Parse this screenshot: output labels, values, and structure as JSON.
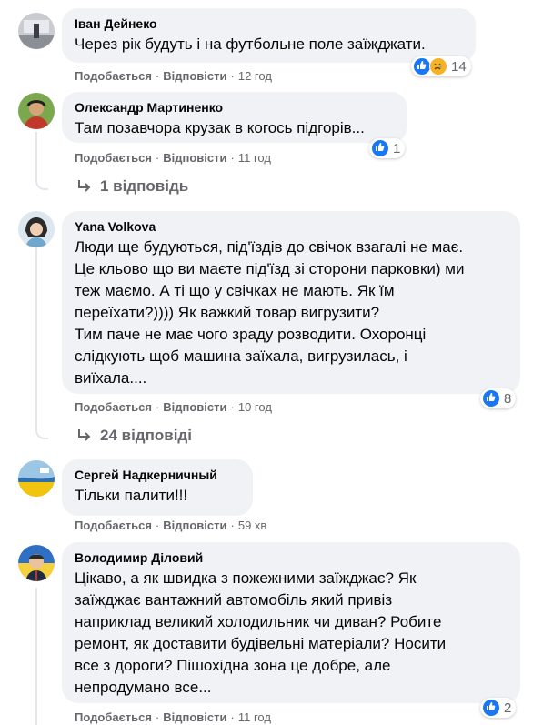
{
  "actions": {
    "like": "Подобається",
    "reply": "Відповісти"
  },
  "comments": [
    {
      "author": "Іван Дейнеко",
      "text": "Через рік будуть і на футбольне поле заїжджати.",
      "time": "12 год",
      "reaction_count": "14"
    },
    {
      "author": "Олександр Мартиненко",
      "text": "Там позавчора крузак в когось підгорів...",
      "time": "11 год",
      "reaction_count": "1",
      "replies_label": "1 відповідь"
    },
    {
      "author": "Yana Volkova",
      "text": "Люди ще будуються, під'їздів до свічок взагалі не має.\nЦе кльово що ви маєте під'їзд зі сторони парковки) ми\nтеж маємо. А ті що у свічках не мають. Як їм\nпереїхати?)))) Як важкий товар вигрузити?\nТим паче не має чого зраду розводити. Охоронці\nслідкують щоб машина заїхала, вигрузилась, і\nвиїхала....",
      "time": "10 год",
      "reaction_count": "8",
      "replies_label": "24 відповіді"
    },
    {
      "author": "Сергей Надкерничный",
      "text": "Тільки палити!!!",
      "time": "59 хв"
    },
    {
      "author": "Володимир Діловий",
      "text": "Цікаво, а як швидка з пожежними заїжджає? Як\nзаїжджає вантажний автомобіль який привіз\nнаприклад великий холодильник чи диван? Робите\nремонт, як доставити будівельні матеріали? Носити\nвсе з дороги? Пішохідна зона це добре, але\nнепродумано все...",
      "time": "11 год",
      "reaction_count": "2"
    }
  ],
  "colors": {
    "like": "#1877f2",
    "sad": "#f7b125",
    "secondary_text": "#65676b",
    "bubble": "#f0f2f5"
  },
  "icons": {
    "like": "like-reaction-icon",
    "sad": "sad-reaction-icon",
    "reply_arrow": "reply-arrow-icon"
  }
}
